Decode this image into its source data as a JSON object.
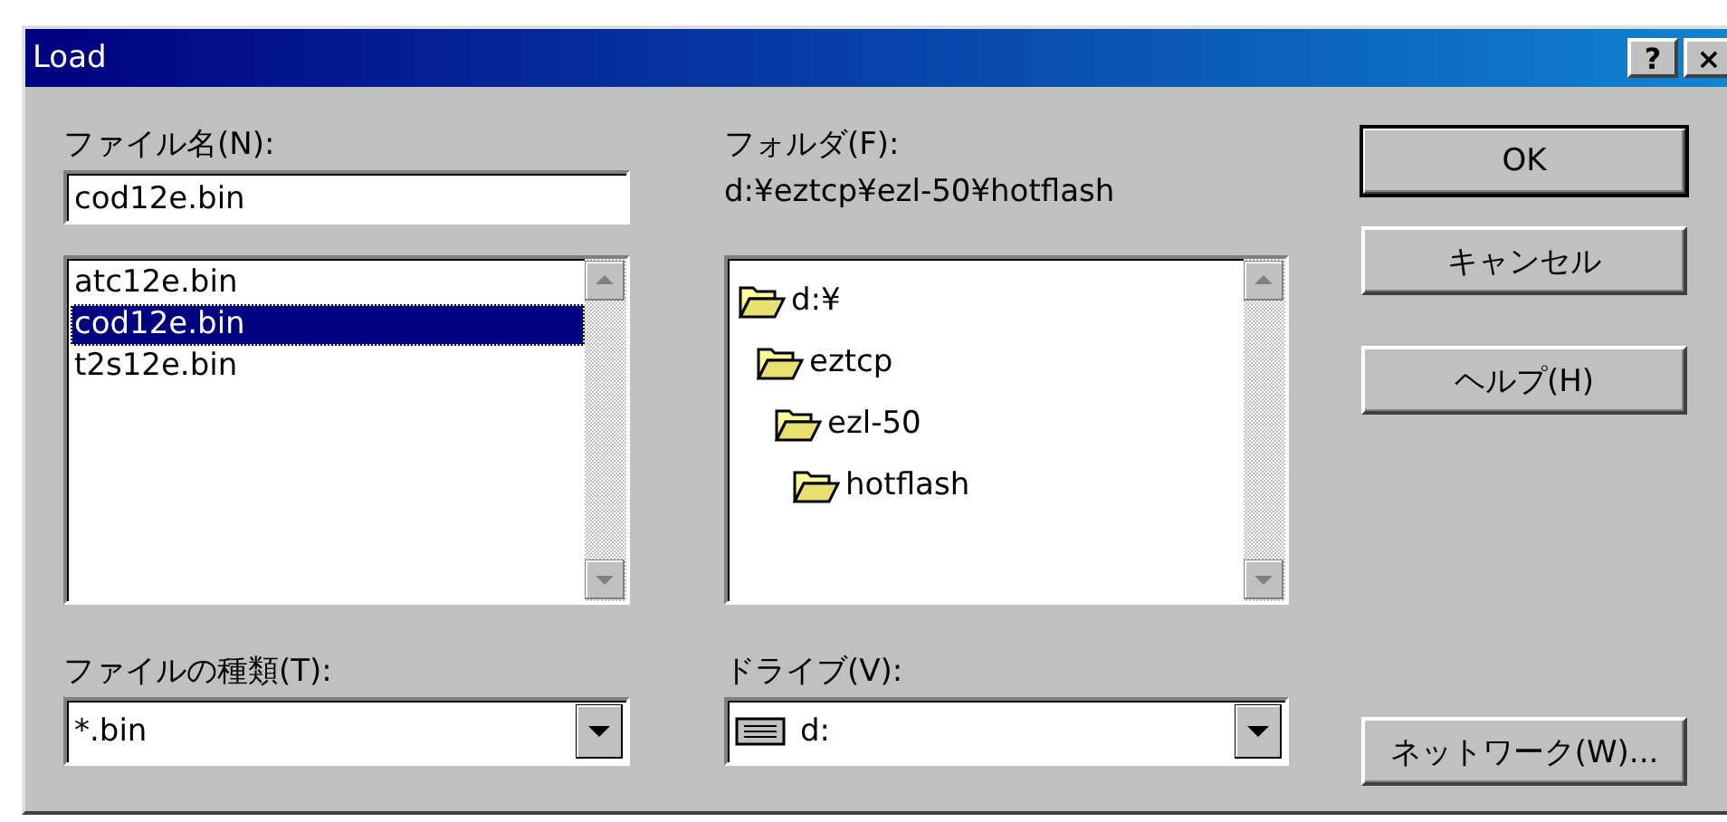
{
  "window": {
    "title": "Load",
    "help_button": "?",
    "close_button": "×"
  },
  "file_name": {
    "label": "ファイル名(N):",
    "value": "cod12e.bin"
  },
  "files": [
    {
      "name": "atc12e.bin",
      "selected": false
    },
    {
      "name": "cod12e.bin",
      "selected": true
    },
    {
      "name": "t2s12e.bin",
      "selected": false
    }
  ],
  "file_type": {
    "label": "ファイルの種類(T):",
    "value": "*.bin"
  },
  "folder": {
    "label": "フォルダ(F):",
    "path": "d:¥eztcp¥ezl-50¥hotflash"
  },
  "folders": [
    {
      "name": "d:¥",
      "children": [
        {
          "name": "eztcp",
          "children": [
            {
              "name": "ezl-50",
              "children": [
                {
                  "name": "hotflash"
                }
              ]
            }
          ]
        }
      ]
    }
  ],
  "drive": {
    "label": "ドライブ(V):",
    "value": "d:"
  },
  "buttons": [
    {
      "kind": "ok",
      "label": "OK",
      "default": true
    },
    {
      "kind": "cancel",
      "label": "キャンセル",
      "default": false
    },
    {
      "kind": "help",
      "label": "ヘルプ(H)",
      "default": false
    }
  ],
  "network_button": {
    "label": "ネットワーク(W)..."
  }
}
